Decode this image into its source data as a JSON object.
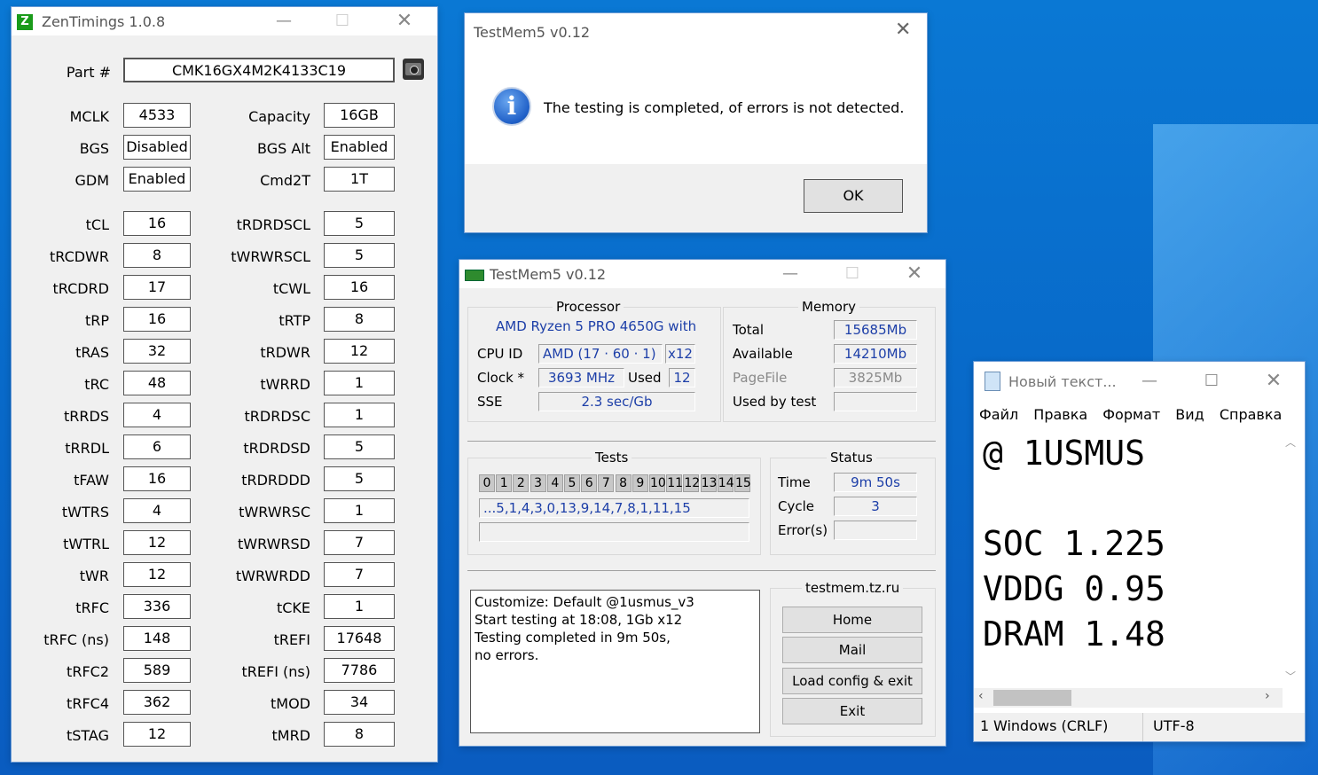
{
  "zentimings": {
    "title": "ZenTimings 1.0.8",
    "logo": "Z",
    "part_label": "Part #",
    "part_value": "CMK16GX4M2K4133C19",
    "screenshot_icon": "camera-icon",
    "rows": [
      {
        "l1": "MCLK",
        "v1": "4533",
        "l2": "Capacity",
        "v2": "16GB"
      },
      {
        "l1": "BGS",
        "v1": "Disabled",
        "l2": "BGS Alt",
        "v2": "Enabled"
      },
      {
        "l1": "GDM",
        "v1": "Enabled",
        "l2": "Cmd2T",
        "v2": "1T"
      },
      {
        "l1": "tCL",
        "v1": "16",
        "l2": "tRDRDSCL",
        "v2": "5"
      },
      {
        "l1": "tRCDWR",
        "v1": "8",
        "l2": "tWRWRSCL",
        "v2": "5"
      },
      {
        "l1": "tRCDRD",
        "v1": "17",
        "l2": "tCWL",
        "v2": "16"
      },
      {
        "l1": "tRP",
        "v1": "16",
        "l2": "tRTP",
        "v2": "8"
      },
      {
        "l1": "tRAS",
        "v1": "32",
        "l2": "tRDWR",
        "v2": "12"
      },
      {
        "l1": "tRC",
        "v1": "48",
        "l2": "tWRRD",
        "v2": "1"
      },
      {
        "l1": "tRRDS",
        "v1": "4",
        "l2": "tRDRDSC",
        "v2": "1"
      },
      {
        "l1": "tRRDL",
        "v1": "6",
        "l2": "tRDRDSD",
        "v2": "5"
      },
      {
        "l1": "tFAW",
        "v1": "16",
        "l2": "tRDRDDD",
        "v2": "5"
      },
      {
        "l1": "tWTRS",
        "v1": "4",
        "l2": "tWRWRSC",
        "v2": "1"
      },
      {
        "l1": "tWTRL",
        "v1": "12",
        "l2": "tWRWRSD",
        "v2": "7"
      },
      {
        "l1": "tWR",
        "v1": "12",
        "l2": "tWRWRDD",
        "v2": "7"
      },
      {
        "l1": "tRFC",
        "v1": "336",
        "l2": "tCKE",
        "v2": "1"
      },
      {
        "l1": "tRFC (ns)",
        "v1": "148",
        "l2": "tREFI",
        "v2": "17648"
      },
      {
        "l1": "tRFC2",
        "v1": "589",
        "l2": "tREFI (ns)",
        "v2": "7786"
      },
      {
        "l1": "tRFC4",
        "v1": "362",
        "l2": "tMOD",
        "v2": "34"
      },
      {
        "l1": "tSTAG",
        "v1": "12",
        "l2": "tMRD",
        "v2": "8"
      }
    ]
  },
  "dialog": {
    "title": "TestMem5 v0.12",
    "message": "The testing is completed, of errors is not detected.",
    "ok_label": "OK"
  },
  "testmem": {
    "title": "TestMem5 v0.12",
    "processor_title": "Processor",
    "cpu_name": "AMD Ryzen 5 PRO 4650G with",
    "cpu_id_label": "CPU ID",
    "cpu_id_value": "AMD  (17 · 60 · 1)",
    "cpu_threads": "x12",
    "clock_label": "Clock *",
    "clock_value": "3693 MHz",
    "used_label": "Used",
    "used_value": "12",
    "sse_label": "SSE",
    "sse_value": "2.3 sec/Gb",
    "memory_title": "Memory",
    "total_label": "Total",
    "total_value": "15685Mb",
    "available_label": "Available",
    "available_value": "14210Mb",
    "pagefile_label": "PageFile",
    "pagefile_value": "3825Mb",
    "usedbytest_label": "Used by test",
    "usedbytest_value": "",
    "tests_title": "Tests",
    "test_cells": [
      "0",
      "1",
      "2",
      "3",
      "4",
      "5",
      "6",
      "7",
      "8",
      "9",
      "10",
      "11",
      "12",
      "13",
      "14",
      "15"
    ],
    "test_sequence": "...5,1,4,3,0,13,9,14,7,8,1,11,15",
    "status_title": "Status",
    "time_label": "Time",
    "time_value": "9m 50s",
    "cycle_label": "Cycle",
    "cycle_value": "3",
    "errors_label": "Error(s)",
    "errors_value": "",
    "log_lines": [
      "Customize: Default @1usmus_v3",
      "Start testing at 18:08, 1Gb x12",
      "Testing completed in 9m 50s,",
      "no errors."
    ],
    "site_title": "testmem.tz.ru",
    "home_label": "Home",
    "mail_label": "Mail",
    "load_label": "Load config & exit",
    "exit_label": "Exit"
  },
  "notepad": {
    "title": "Новый текст...",
    "menu": [
      "Файл",
      "Правка",
      "Формат",
      "Вид",
      "Справка"
    ],
    "lines": [
      "@ 1USMUS",
      "",
      "SOC 1.225",
      "VDDG 0.95",
      "DRAM 1.48"
    ],
    "status_line": "1",
    "status_eol": "Windows (CRLF)",
    "status_enc": "UTF-8"
  },
  "colors": {
    "accent": "#0a78d4",
    "value_blue": "#1d3fa8",
    "info_blue": "#1f5fc7"
  }
}
